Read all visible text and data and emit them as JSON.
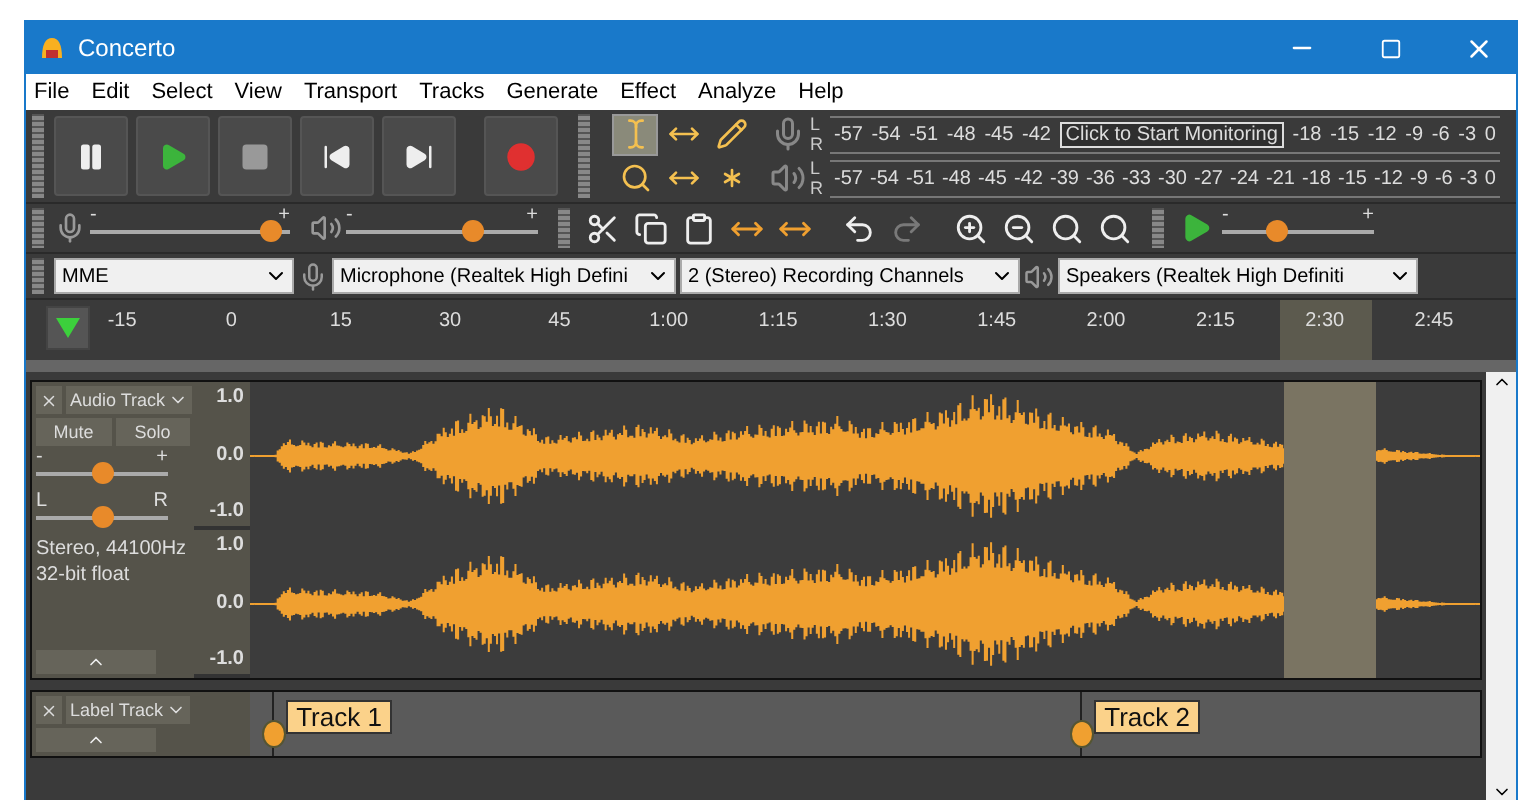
{
  "window": {
    "title": "Concerto"
  },
  "menu": [
    "File",
    "Edit",
    "Select",
    "View",
    "Transport",
    "Tracks",
    "Generate",
    "Effect",
    "Analyze",
    "Help"
  ],
  "transport": [
    {
      "kind": "pause"
    },
    {
      "kind": "play"
    },
    {
      "kind": "stop"
    },
    {
      "kind": "start"
    },
    {
      "kind": "end"
    },
    {
      "kind": "record"
    }
  ],
  "tools": [
    {
      "kind": "select",
      "selected": true
    },
    {
      "kind": "envelope",
      "selected": false
    },
    {
      "kind": "draw",
      "selected": false
    },
    {
      "kind": "zoom",
      "selected": false
    },
    {
      "kind": "timeshift",
      "selected": false
    },
    {
      "kind": "multi",
      "selected": false
    }
  ],
  "record_meter": {
    "channels": [
      "L",
      "R"
    ],
    "ticks_before": [
      "-57",
      "-54",
      "-51",
      "-48",
      "-45",
      "-42"
    ],
    "tooltip": "Click to Start Monitoring",
    "ticks_after": [
      "-18",
      "-15",
      "-12",
      "-9",
      "-6",
      "-3",
      "0"
    ]
  },
  "play_meter": {
    "channels": [
      "L",
      "R"
    ],
    "ticks": [
      "-57",
      "-54",
      "-51",
      "-48",
      "-45",
      "-42",
      "-39",
      "-36",
      "-33",
      "-30",
      "-27",
      "-24",
      "-21",
      "-18",
      "-15",
      "-12",
      "-9",
      "-6",
      "-3",
      "0"
    ]
  },
  "mixer": {
    "record": {
      "level": 0.9,
      "minus": "-",
      "plus": "+"
    },
    "play": {
      "level": 0.66,
      "minus": "-",
      "plus": "+"
    }
  },
  "edit_tools": [
    {
      "kind": "cut",
      "disabled": false
    },
    {
      "kind": "copy",
      "disabled": false
    },
    {
      "kind": "paste",
      "disabled": false
    },
    {
      "kind": "trim",
      "disabled": false
    },
    {
      "kind": "silence",
      "disabled": false
    },
    {
      "kind": "undo",
      "disabled": false
    },
    {
      "kind": "redo",
      "disabled": true
    },
    {
      "kind": "zoomin",
      "disabled": false
    },
    {
      "kind": "zoomout",
      "disabled": false
    },
    {
      "kind": "fitsel",
      "disabled": false
    },
    {
      "kind": "fitproject",
      "disabled": false
    }
  ],
  "play_at_speed": {
    "level": 0.35,
    "minus": "-",
    "plus": "+"
  },
  "devices": {
    "host": "MME",
    "microphone": "Microphone (Realtek High Defini",
    "channels": "2 (Stereo) Recording Channels",
    "speakers": "Speakers (Realtek High Definiti"
  },
  "ruler": {
    "ticks": [
      "-15",
      "0",
      "15",
      "30",
      "45",
      "1:00",
      "1:15",
      "1:30",
      "1:45",
      "2:00",
      "2:15",
      "2:30",
      "2:45"
    ]
  },
  "audio_track": {
    "name": "Audio Track",
    "mute": "Mute",
    "solo": "Solo",
    "gain": {
      "minus": "-",
      "plus": "+",
      "level": 0.5
    },
    "pan": {
      "left": "L",
      "right": "R",
      "level": 0.5
    },
    "info": [
      "Stereo, 44100Hz",
      "32-bit float"
    ],
    "channels": [
      {
        "scale": [
          "1.0",
          "0.0",
          "-1.0"
        ]
      },
      {
        "scale": [
          "1.0",
          "0.0",
          "-1.0"
        ]
      }
    ]
  },
  "label_track": {
    "name": "Label Track",
    "labels": [
      "Track 1",
      "Track 2"
    ]
  }
}
